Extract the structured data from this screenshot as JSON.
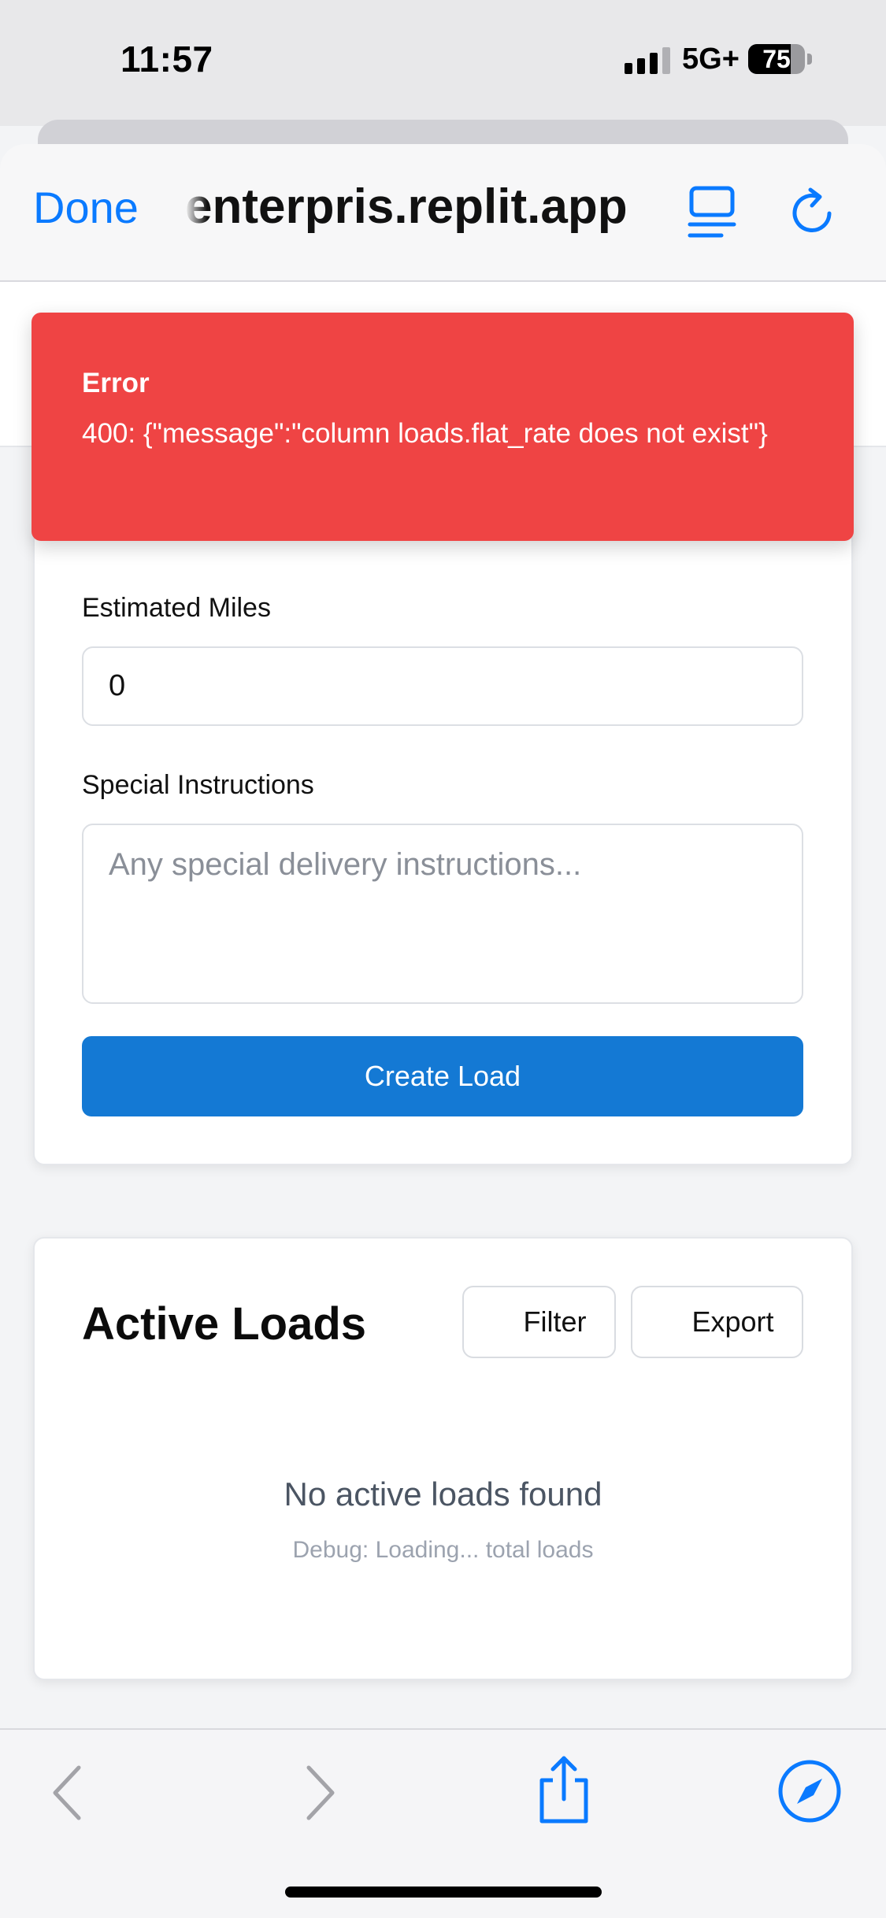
{
  "status_bar": {
    "time": "11:57",
    "network": "5G+",
    "battery": "75",
    "battery_level": 0.75
  },
  "browser": {
    "done_label": "Done",
    "url": "enterpris.replit.app",
    "accent_color": "#0a7aff",
    "icons": [
      "reader-mode-icon",
      "reload-icon",
      "back-icon",
      "forward-icon",
      "share-icon",
      "compass-icon"
    ]
  },
  "toast": {
    "title": "Error",
    "message": "400: {\"message\":\"column loads.flat_rate does not exist\"}",
    "color": "#ef4444"
  },
  "form": {
    "miles_label": "Estimated Miles",
    "miles_value": "0",
    "instructions_label": "Special Instructions",
    "instructions_placeholder": "Any special delivery instructions...",
    "submit_label": "Create Load",
    "submit_color": "#1479d4"
  },
  "loads": {
    "title": "Active Loads",
    "filter_label": "Filter",
    "export_label": "Export",
    "empty_message": "No active loads found",
    "debug_message": "Debug: Loading... total loads"
  }
}
